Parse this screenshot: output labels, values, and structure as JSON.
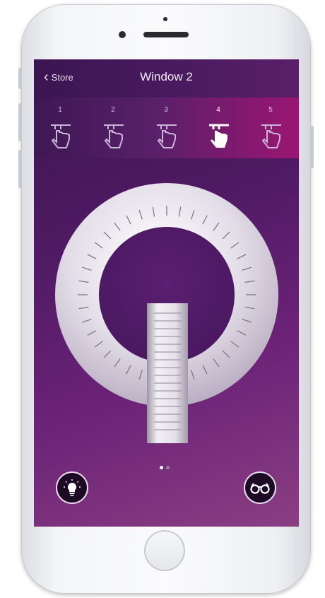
{
  "nav": {
    "back_label": "Store",
    "title": "Window 2"
  },
  "tabs": [
    {
      "number": "1",
      "icon": "hand-press-icon",
      "active": false
    },
    {
      "number": "2",
      "icon": "hand-press-icon",
      "active": false
    },
    {
      "number": "3",
      "icon": "hand-press-icon",
      "active": false
    },
    {
      "number": "4",
      "icon": "hand-press-icon",
      "active": true
    },
    {
      "number": "5",
      "icon": "hand-press-icon",
      "active": false
    }
  ],
  "controls": {
    "dial": "rotary-dial",
    "slider": "vertical-slider",
    "page_indicator": {
      "pages": 2,
      "current": 1
    }
  },
  "buttons": {
    "left_icon": "lightbulb-icon",
    "right_icon": "glasses-icon"
  },
  "colors": {
    "accent": "#9a1673",
    "screen_bg": "#4f1a63"
  }
}
